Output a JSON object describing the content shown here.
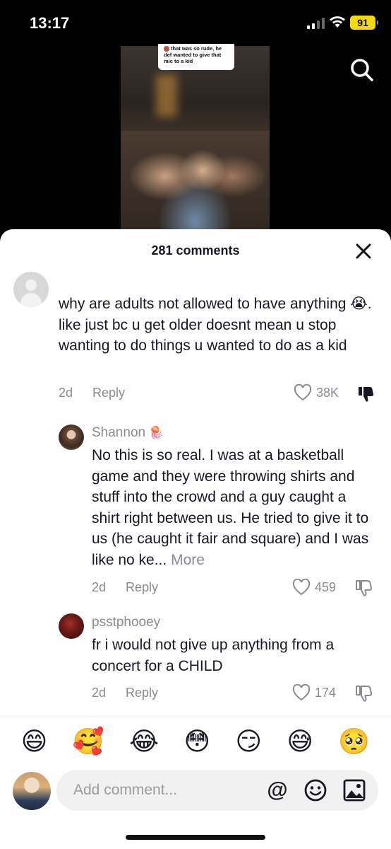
{
  "status_bar": {
    "time": "13:17",
    "battery": "91"
  },
  "video": {
    "caption": "that was so rude, he def wanted to give that mic to a kid"
  },
  "comments_sheet": {
    "title": "281 comments",
    "comments": [
      {
        "username": "",
        "text": "why are adults not allowed to have anything 😭. like just bc u get older doesnt mean u stop wanting to do things u wanted to do as a kid",
        "date": "2d",
        "reply_label": "Reply",
        "likes": "38K",
        "disliked": true
      },
      {
        "username": "Shannon",
        "username_badge": "🪼",
        "text": "No this is so real. I was at a basketball game and they were throwing shirts and stuff into the crowd and a guy caught a shirt right between us. He tried to give it to us (he caught it fair and square) and I was like no ke...",
        "more_label": "More",
        "date": "2d",
        "reply_label": "Reply",
        "likes": "459",
        "disliked": false
      },
      {
        "username": "psstphooey",
        "text": "fr i would not give up anything from a concert for a CHILD",
        "date": "2d",
        "reply_label": "Reply",
        "likes": "174",
        "disliked": false
      }
    ]
  },
  "emoji_bar": [
    "😄",
    "🥰",
    "😂",
    "😳",
    "😏",
    "😅",
    "🥺"
  ],
  "composer": {
    "placeholder": "Add comment...",
    "mention_symbol": "@"
  }
}
